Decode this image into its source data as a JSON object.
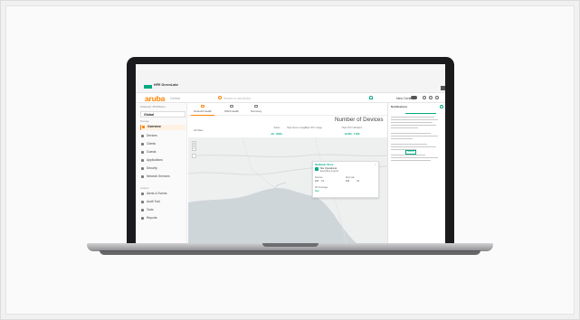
{
  "hpe": {
    "brand": "HPE GreenLake"
  },
  "header": {
    "logo": "aruba",
    "product": "Central",
    "search_placeholder": "Search or ask Aruba",
    "new_central_label": "New Central"
  },
  "sidebar": {
    "customer_label": "Customer: PLM Demo",
    "scope_label": "Global",
    "manage_label": "Manage",
    "items": [
      {
        "label": "Overview",
        "icon": "overview-icon",
        "active": true
      },
      {
        "label": "Devices",
        "icon": "devices-icon"
      },
      {
        "label": "Clients",
        "icon": "clients-icon"
      },
      {
        "label": "Guests",
        "icon": "guests-icon"
      },
      {
        "label": "Applications",
        "icon": "applications-icon"
      },
      {
        "label": "Security",
        "icon": "security-icon"
      },
      {
        "label": "Network Services",
        "icon": "network-services-icon"
      }
    ],
    "analyze_label": "Analyze",
    "analyze_items": [
      {
        "label": "Alerts & Events",
        "icon": "alerts-icon"
      },
      {
        "label": "Audit Trail",
        "icon": "audit-icon"
      },
      {
        "label": "Tools",
        "icon": "tools-icon"
      },
      {
        "label": "Reports",
        "icon": "reports-icon"
      }
    ]
  },
  "tabs": [
    {
      "label": "Network Health",
      "active": true
    },
    {
      "label": "WAN Health"
    },
    {
      "label": "Summary"
    }
  ],
  "content": {
    "filter_label": "All Sites",
    "metrics": [
      {
        "label": "Status",
        "value": "All · 2000+"
      },
      {
        "label": "High Device Usage",
        "value": ""
      },
      {
        "label": "High CPU Usage",
        "value": ""
      },
      {
        "label": "High CPU Utilization",
        "value": "12,000 · 7,000"
      }
    ],
    "map_heading": "Number of Devices"
  },
  "popup": {
    "title": "Redlands Store",
    "status": "Site Operational",
    "sub": "Everything is good",
    "col1_label": "Devices",
    "col1_value": "115",
    "col1_extra": "Ok",
    "col2_label": "Alert rate",
    "col2_value": "115",
    "col2_extra": "Ok",
    "coverage_label": "AP Coverage",
    "link": "Map"
  },
  "right_panel": {
    "title": "Notifications",
    "button_label": "View all"
  },
  "colors": {
    "accent": "#ff8300",
    "brand_green": "#01a982",
    "pin": "#e03c31"
  }
}
